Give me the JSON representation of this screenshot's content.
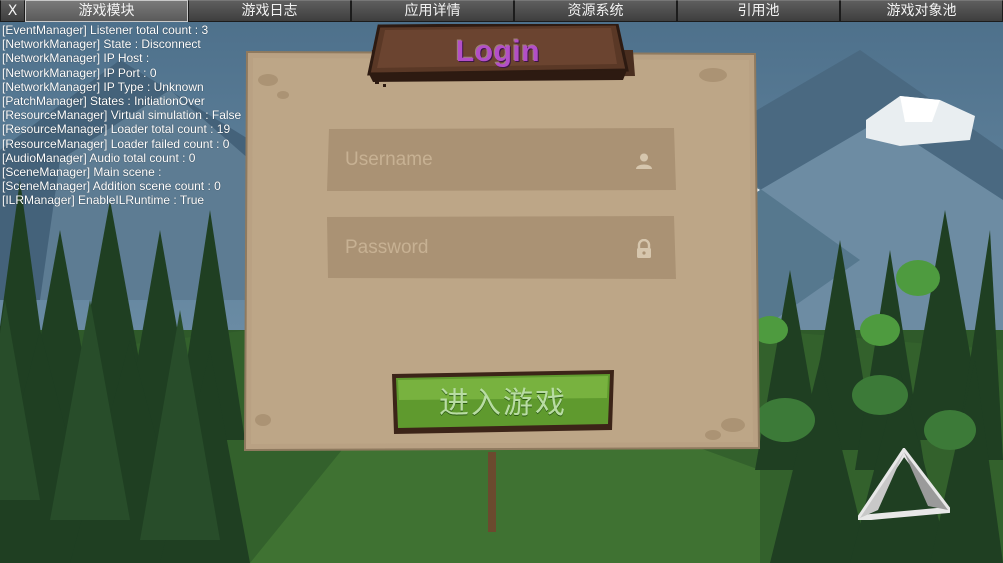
{
  "debug_bar": {
    "close_label": "X",
    "tabs": [
      {
        "label": "游戏模块",
        "active": true
      },
      {
        "label": "游戏日志",
        "active": false
      },
      {
        "label": "应用详情",
        "active": false
      },
      {
        "label": "资源系统",
        "active": false
      },
      {
        "label": "引用池",
        "active": false
      },
      {
        "label": "游戏对象池",
        "active": false
      }
    ]
  },
  "debug_log": [
    "[EventManager] Listener total count : 3",
    "[NetworkManager] State : Disconnect",
    "[NetworkManager] IP Host :",
    "[NetworkManager] IP Port : 0",
    "[NetworkManager] IP Type : Unknown",
    "[PatchManager] States : InitiationOver",
    "[ResourceManager] Virtual simulation : False",
    "[ResourceManager] Loader total count : 19",
    "[ResourceManager] Loader failed count : 0",
    "[AudioManager] Audio total count : 0",
    "[SceneManager] Main scene :",
    "[SceneManager] Addition scene count : 0",
    "[ILRManager] EnableILRuntime : True"
  ],
  "login": {
    "title": "Login",
    "username": {
      "value": "",
      "placeholder": "Username",
      "icon": "user-icon"
    },
    "password": {
      "value": "",
      "placeholder": "Password",
      "icon": "lock-icon"
    },
    "enter_button_label": "进入游戏"
  },
  "colors": {
    "title": "#b34fc7",
    "panel": "#b9a183",
    "button_green": "#5f9a2e",
    "sky": "#5b7f9a"
  }
}
